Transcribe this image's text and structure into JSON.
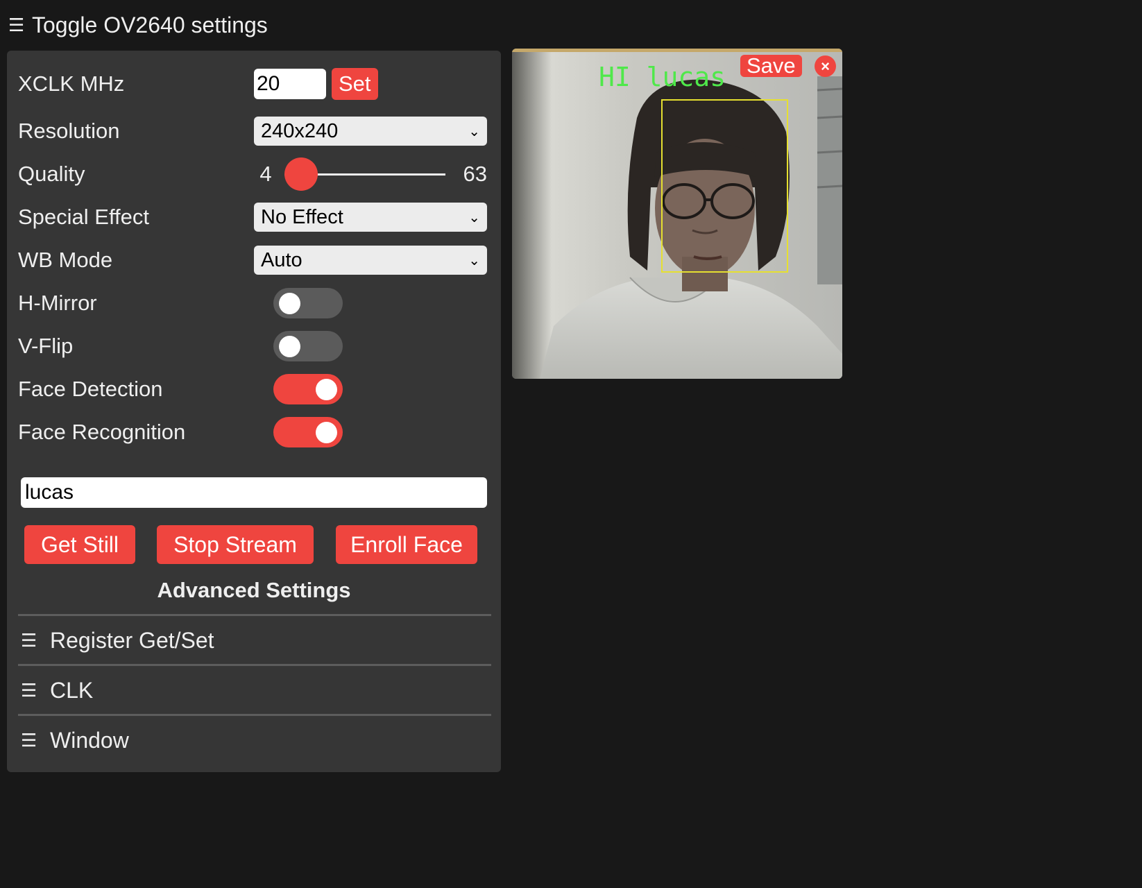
{
  "header": {
    "menu_icon": "hamburger-icon",
    "title": "Toggle OV2640 settings"
  },
  "settings": {
    "xclk": {
      "label": "XCLK MHz",
      "value": "20",
      "button": "Set"
    },
    "resolution": {
      "label": "Resolution",
      "selected": "240x240"
    },
    "quality": {
      "label": "Quality",
      "min": "4",
      "max": "63",
      "value": 10
    },
    "special_effect": {
      "label": "Special Effect",
      "selected": "No Effect"
    },
    "wb_mode": {
      "label": "WB Mode",
      "selected": "Auto"
    },
    "h_mirror": {
      "label": "H-Mirror",
      "on": false
    },
    "v_flip": {
      "label": "V-Flip",
      "on": false
    },
    "face_detection": {
      "label": "Face Detection",
      "on": true
    },
    "face_recognition": {
      "label": "Face Recognition",
      "on": true
    },
    "face_name": {
      "value": "lucas"
    }
  },
  "actions": {
    "get_still": "Get Still",
    "stop_stream": "Stop Stream",
    "enroll_face": "Enroll Face"
  },
  "advanced": {
    "title": "Advanced Settings",
    "sections": [
      {
        "label": "Register Get/Set"
      },
      {
        "label": "CLK"
      },
      {
        "label": "Window"
      }
    ]
  },
  "stream": {
    "overlay_text": "HI lucas",
    "save_label": "Save",
    "close_glyph": "×"
  },
  "colors": {
    "accent": "#ef453f",
    "panel": "#363636",
    "background": "#181818",
    "overlay_text": "#4fe84a",
    "face_box": "#e6e030"
  }
}
